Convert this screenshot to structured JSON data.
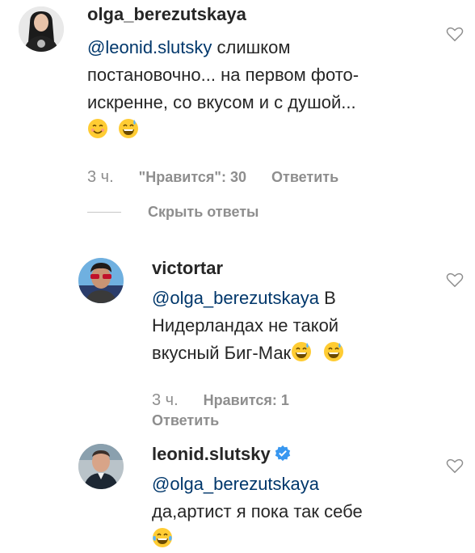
{
  "comments": [
    {
      "username": "olga_berezutskaya",
      "mention": "@leonid.slutsky",
      "line1_rest": " слишком",
      "line2": "постановочно... на первом фото-",
      "line3": "искренне, со вкусом и с душой...",
      "emojis": [
        "smiling-face-icon",
        "grinning-sweat-icon"
      ],
      "time": "3 ч.",
      "likes": "\"Нравится\": 30",
      "reply": "Ответить",
      "hide_replies": "Скрыть ответы"
    },
    {
      "username": "victortar",
      "mention": "@olga_berezutskaya",
      "line1_rest": " В",
      "line2": "Нидерландах не такой",
      "line3": "вкусный Биг-Мак",
      "emojis": [
        "grinning-sweat-icon",
        "grinning-sweat-icon"
      ],
      "time": "3 ч.",
      "likes": "Нравится: 1",
      "reply": "Ответить"
    },
    {
      "username": "leonid.slutsky",
      "verified": true,
      "mention": "@olga_berezutskaya",
      "line2": "да,артист я пока так себе",
      "emojis": [
        "tears-of-joy-icon"
      ]
    }
  ],
  "colors": {
    "text": "#262626",
    "secondary": "#8e8e8e",
    "mention": "#00376b",
    "verified": "#3897f0",
    "emoji": "#ffcc33"
  }
}
